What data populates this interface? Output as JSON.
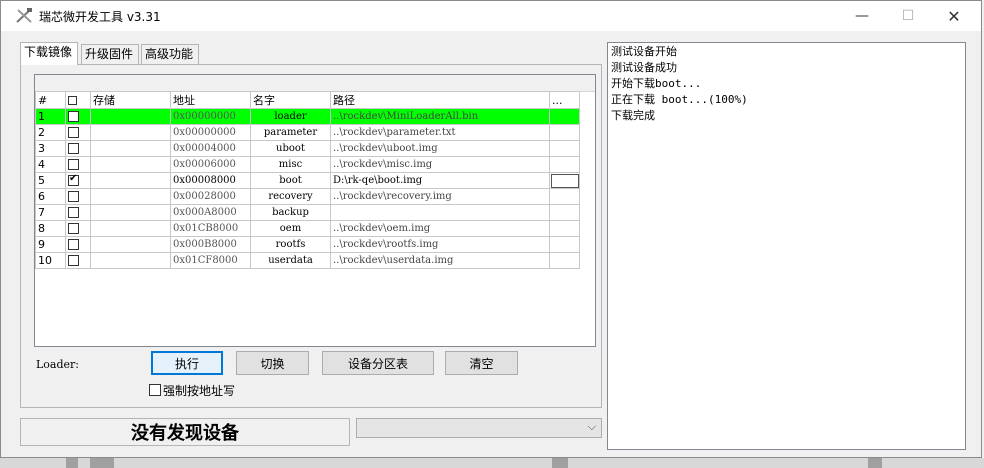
{
  "window": {
    "title": "瑞芯微开发工具 v3.31"
  },
  "tabs": [
    {
      "label": "下载镜像",
      "active": true
    },
    {
      "label": "升级固件",
      "active": false
    },
    {
      "label": "高级功能",
      "active": false
    }
  ],
  "table": {
    "headers": {
      "index": "#",
      "storage": "存储",
      "address": "地址",
      "name": "名字",
      "path": "路径",
      "extra": "..."
    },
    "rows": [
      {
        "index": "1",
        "checked": false,
        "address": "0x00000000",
        "name": "loader",
        "path": "..\\rockdev\\MiniLoaderAll.bin",
        "highlight": true
      },
      {
        "index": "2",
        "checked": false,
        "address": "0x00000000",
        "name": "parameter",
        "path": "..\\rockdev\\parameter.txt"
      },
      {
        "index": "3",
        "checked": false,
        "address": "0x00004000",
        "name": "uboot",
        "path": "..\\rockdev\\uboot.img"
      },
      {
        "index": "4",
        "checked": false,
        "address": "0x00006000",
        "name": "misc",
        "path": "..\\rockdev\\misc.img"
      },
      {
        "index": "5",
        "checked": true,
        "address": "0x00008000",
        "name": "boot",
        "path": "D:\\rk-qe\\boot.img",
        "selected": true
      },
      {
        "index": "6",
        "checked": false,
        "address": "0x00028000",
        "name": "recovery",
        "path": "..\\rockdev\\recovery.img"
      },
      {
        "index": "7",
        "checked": false,
        "address": "0x000A8000",
        "name": "backup",
        "path": ""
      },
      {
        "index": "8",
        "checked": false,
        "address": "0x01CB8000",
        "name": "oem",
        "path": "..\\rockdev\\oem.img"
      },
      {
        "index": "9",
        "checked": false,
        "address": "0x000B8000",
        "name": "rootfs",
        "path": "..\\rockdev\\rootfs.img"
      },
      {
        "index": "10",
        "checked": false,
        "address": "0x01CF8000",
        "name": "userdata",
        "path": "..\\rockdev\\userdata.img"
      }
    ]
  },
  "loader_label": "Loader:",
  "buttons": {
    "run": "执行",
    "switch": "切换",
    "partition": "设备分区表",
    "clear": "清空"
  },
  "force_address_label": "强制按地址写",
  "status": "没有发现设备",
  "log": [
    "测试设备开始",
    "测试设备成功",
    "开始下载boot...",
    "正在下载 boot...(100%)",
    "下载完成"
  ],
  "colors": {
    "highlight_row": "#00ff00",
    "default_button_border": "#0078d7"
  }
}
